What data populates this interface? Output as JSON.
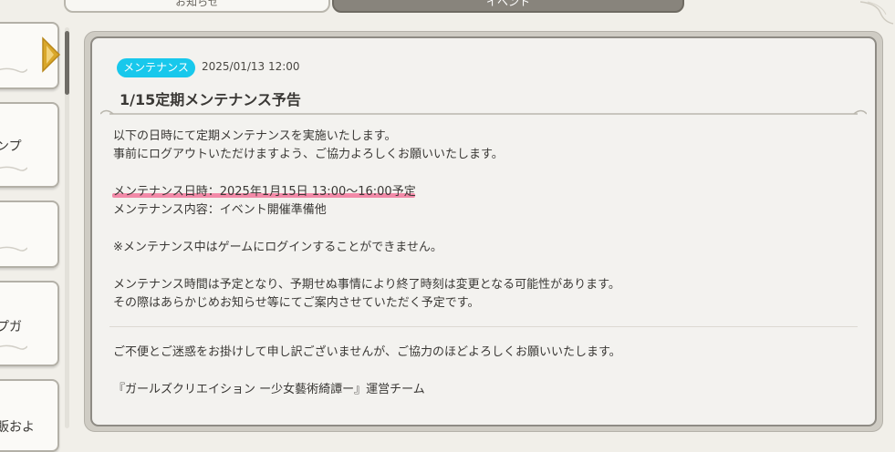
{
  "tabs": [
    {
      "label": "お知らせ",
      "active": false
    },
    {
      "label": "イベント",
      "active": true
    }
  ],
  "sidebar": {
    "items": [
      {
        "label": ""
      },
      {
        "label": "ンプ"
      },
      {
        "label": ""
      },
      {
        "label": "プガ"
      },
      {
        "label": "販およ"
      }
    ]
  },
  "article": {
    "badge": "メンテナンス",
    "date": "2025/01/13 12:00",
    "title": "1/15定期メンテナンス予告",
    "paragraphs": {
      "p1": "以下の日時にて定期メンテナンスを実施いたします。",
      "p2": "事前にログアウトいただけますよう、ご協力よろしくお願いいたします。",
      "p3": "メンテナンス日時：2025年1月15日 13:00～16:00予定",
      "p4": "メンテナンス内容：イベント開催準備他",
      "p5": "※メンテナンス中はゲームにログインすることができません。",
      "p6": "メンテナンス時間は予定となり、予期せぬ事情により終了時刻は変更となる可能性があります。",
      "p7": "その際はあらかじめお知らせ等にてご案内させていただく予定です。",
      "p8": "ご不便とご迷惑をお掛けして申し訳ございませんが、ご協力のほどよろしくお願いいたします。",
      "p9": "『ガールズクリエイション ー少女藝術綺譚ー』運営チーム"
    }
  },
  "colors": {
    "badge": "#18c8ec",
    "highlight": "#f28aa8",
    "active_tab": "#88847c"
  }
}
